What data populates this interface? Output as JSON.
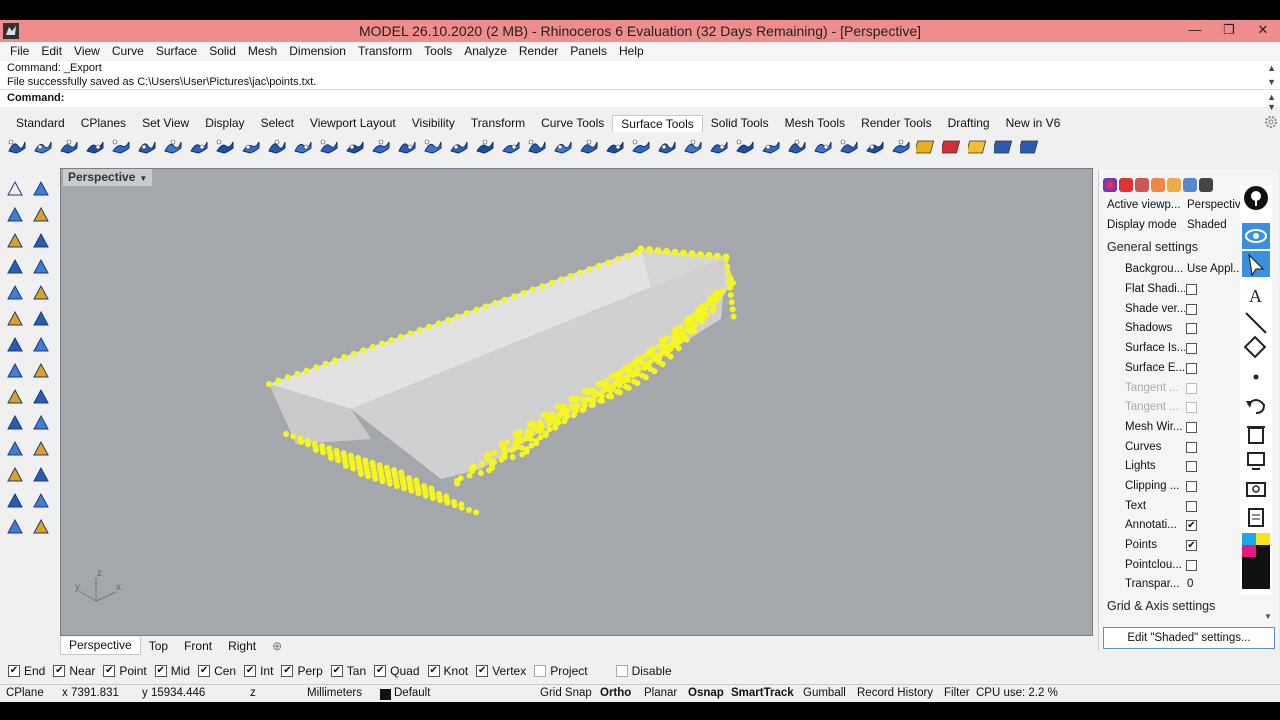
{
  "window": {
    "title": "MODEL 26.10.2020 (2 MB) - Rhinoceros 6 Evaluation (32 Days Remaining) - [Perspective]",
    "minimize": "—",
    "restore": "❐",
    "close": "✕"
  },
  "menu": [
    "File",
    "Edit",
    "View",
    "Curve",
    "Surface",
    "Solid",
    "Mesh",
    "Dimension",
    "Transform",
    "Tools",
    "Analyze",
    "Render",
    "Panels",
    "Help"
  ],
  "command_history": {
    "line1": "Command: _Export",
    "line2": "File successfully saved as C:\\Users\\User\\Pictures\\jac\\points.txt."
  },
  "command_prompt": "Command:",
  "toolbar_tabs": [
    "Standard",
    "CPlanes",
    "Set View",
    "Display",
    "Select",
    "Viewport Layout",
    "Visibility",
    "Transform",
    "Curve Tools",
    "Surface Tools",
    "Solid Tools",
    "Mesh Tools",
    "Render Tools",
    "Drafting",
    "New in V6"
  ],
  "active_tab": "Surface Tools",
  "viewport": {
    "label": "Perspective",
    "axis_x": "x",
    "axis_y": "y",
    "axis_z": "z"
  },
  "viewport_tabs": [
    "Perspective",
    "Top",
    "Front",
    "Right"
  ],
  "add_viewport_icon": "⊕",
  "display_panel": {
    "active_viewport_label": "Active viewp...",
    "active_viewport_value": "Perspective",
    "display_mode_label": "Display mode",
    "display_mode_value": "Shaded",
    "general_settings": "General settings",
    "background_label": "Backgrou...",
    "background_value": "Use Appl...",
    "options": [
      {
        "label": "Flat Shadi...",
        "checked": false,
        "disabled": false
      },
      {
        "label": "Shade ver...",
        "checked": false,
        "disabled": false
      },
      {
        "label": "Shadows",
        "checked": false,
        "disabled": false
      },
      {
        "label": "Surface Is...",
        "checked": false,
        "disabled": false
      },
      {
        "label": "Surface E...",
        "checked": false,
        "disabled": false
      },
      {
        "label": "Tangent ...",
        "checked": false,
        "disabled": true
      },
      {
        "label": "Tangent ...",
        "checked": false,
        "disabled": true
      },
      {
        "label": "Mesh Wir...",
        "checked": false,
        "disabled": false
      },
      {
        "label": "Curves",
        "checked": false,
        "disabled": false
      },
      {
        "label": "Lights",
        "checked": false,
        "disabled": false
      },
      {
        "label": "Clipping ...",
        "checked": false,
        "disabled": false
      },
      {
        "label": "Text",
        "checked": false,
        "disabled": false
      },
      {
        "label": "Annotati...",
        "checked": true,
        "disabled": false
      },
      {
        "label": "Points",
        "checked": true,
        "disabled": false
      },
      {
        "label": "Pointclou...",
        "checked": false,
        "disabled": false
      }
    ],
    "transparency_label": "Transpar...",
    "transparency_value": "0",
    "grid_axis": "Grid & Axis settings",
    "edit_button": "Edit \"Shaded\" settings..."
  },
  "osnaps": [
    {
      "label": "End",
      "checked": true
    },
    {
      "label": "Near",
      "checked": true
    },
    {
      "label": "Point",
      "checked": true
    },
    {
      "label": "Mid",
      "checked": true
    },
    {
      "label": "Cen",
      "checked": true
    },
    {
      "label": "Int",
      "checked": true
    },
    {
      "label": "Perp",
      "checked": true
    },
    {
      "label": "Tan",
      "checked": true
    },
    {
      "label": "Quad",
      "checked": true
    },
    {
      "label": "Knot",
      "checked": true
    },
    {
      "label": "Vertex",
      "checked": true
    },
    {
      "label": "Project",
      "checked": false
    },
    {
      "label": "Disable",
      "checked": false
    }
  ],
  "status": {
    "cplane": "CPlane",
    "x": "x 7391.831",
    "y": "y 15934.446",
    "z": "z",
    "units": "Millimeters",
    "layer": "Default",
    "grid_snap": "Grid Snap",
    "ortho": "Ortho",
    "planar": "Planar",
    "osnap": "Osnap",
    "smarttrack": "SmartTrack",
    "gumball": "Gumball",
    "record_history": "Record History",
    "filter": "Filter",
    "cpu": "CPU use: 2.2 %"
  },
  "colors": {
    "titlebar": "#ef8d8d",
    "viewport_bg": "#a4a8ad",
    "points": "#f5f520"
  }
}
